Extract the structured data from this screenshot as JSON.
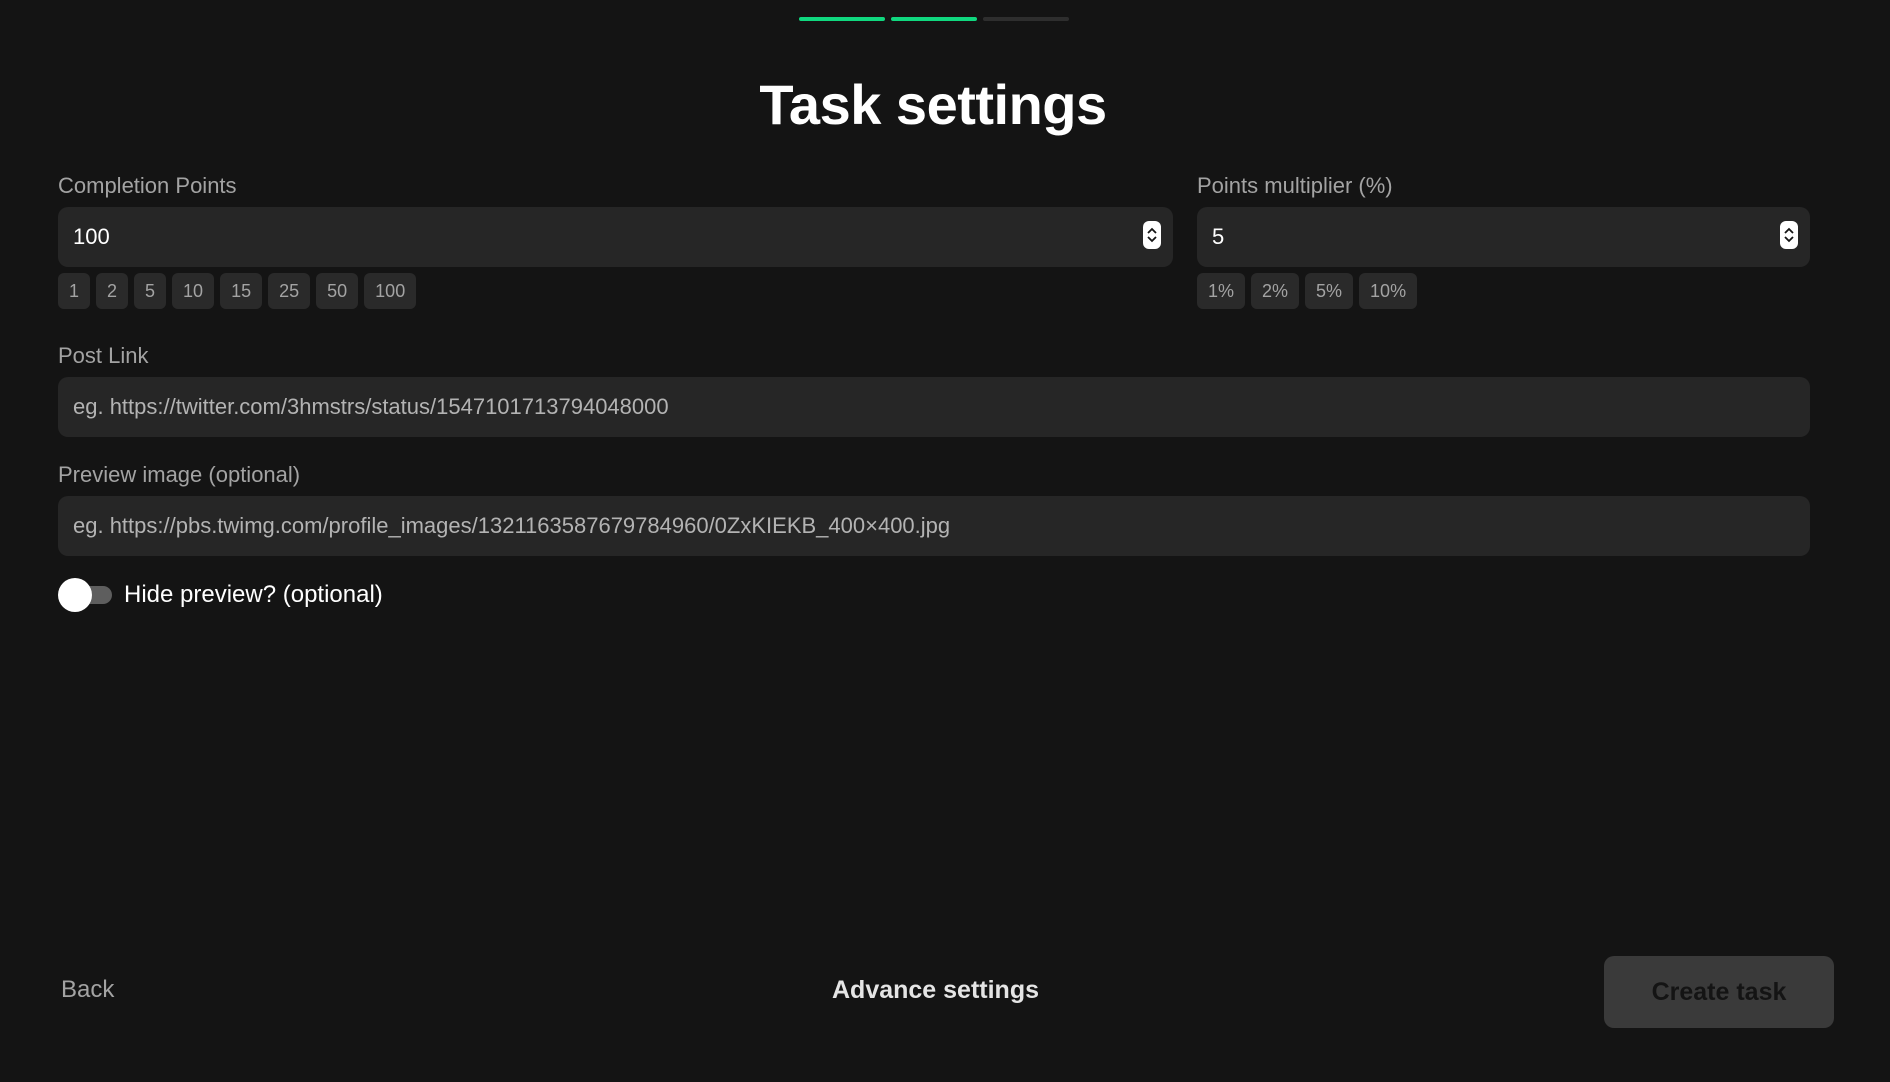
{
  "progress": {
    "steps": [
      "complete",
      "complete",
      "incomplete"
    ],
    "colors": {
      "complete": "#10d87f",
      "incomplete": "#2e2e2e"
    }
  },
  "page_title": "Task settings",
  "completion_points": {
    "label": "Completion Points",
    "value": "100",
    "presets": [
      "1",
      "2",
      "5",
      "10",
      "15",
      "25",
      "50",
      "100"
    ]
  },
  "points_multiplier": {
    "label": "Points multiplier (%)",
    "value": "5",
    "presets": [
      "1%",
      "2%",
      "5%",
      "10%"
    ]
  },
  "post_link": {
    "label": "Post Link",
    "placeholder": "eg. https://twitter.com/3hmstrs/status/1547101713794048000"
  },
  "preview_image": {
    "label": "Preview image (optional)",
    "placeholder": "eg. https://pbs.twimg.com/profile_images/1321163587679784960/0ZxKIEKB_400×400.jpg"
  },
  "hide_preview": {
    "label": "Hide preview? (optional)",
    "checked": false
  },
  "footer": {
    "back_label": "Back",
    "advance_label": "Advance settings",
    "create_label": "Create task"
  },
  "icons": {
    "stepper": "chevron-up-down-icon"
  }
}
